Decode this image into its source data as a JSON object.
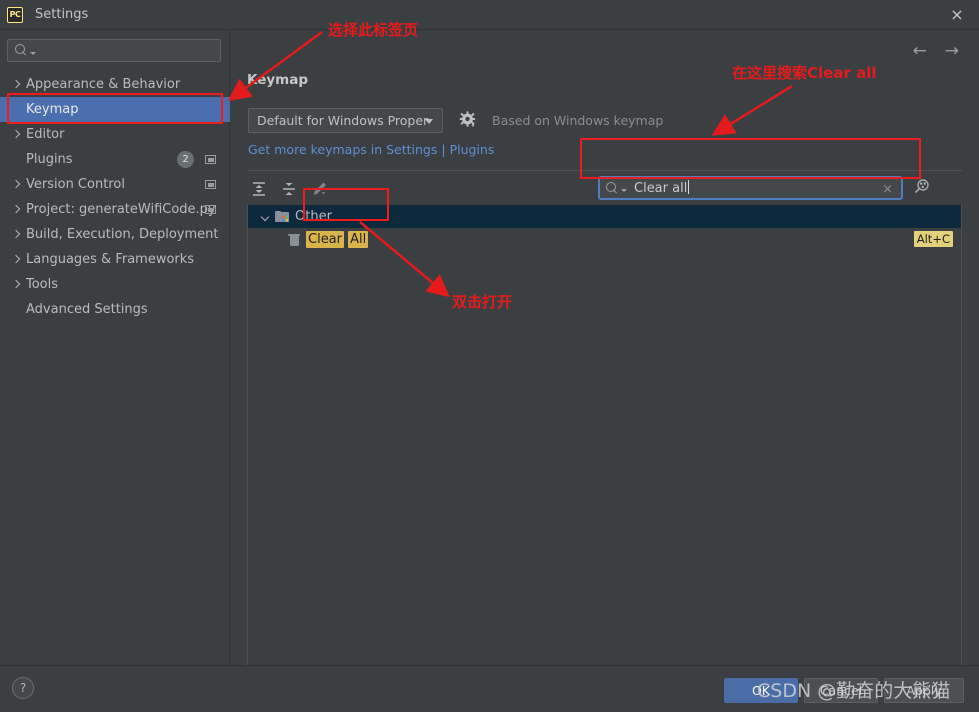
{
  "window": {
    "title": "Settings",
    "app_icon": "pycharm-icon",
    "close_icon": "×"
  },
  "sidebar": {
    "search_placeholder": "",
    "search_icon": "search-icon",
    "items": [
      {
        "label": "Appearance & Behavior",
        "expandable": true,
        "selected": false
      },
      {
        "label": "Keymap",
        "expandable": false,
        "selected": true
      },
      {
        "label": "Editor",
        "expandable": true,
        "selected": false
      },
      {
        "label": "Plugins",
        "expandable": false,
        "selected": false,
        "badge": "2",
        "has_mini": true
      },
      {
        "label": "Version Control",
        "expandable": true,
        "selected": false,
        "has_mini": true
      },
      {
        "label": "Project: generateWifiCode.py",
        "expandable": true,
        "selected": false,
        "has_mini": true
      },
      {
        "label": "Build, Execution, Deployment",
        "expandable": true,
        "selected": false
      },
      {
        "label": "Languages & Frameworks",
        "expandable": true,
        "selected": false
      },
      {
        "label": "Tools",
        "expandable": true,
        "selected": false
      },
      {
        "label": "Advanced Settings",
        "expandable": false,
        "selected": false
      }
    ]
  },
  "content": {
    "panel_title": "Keymap",
    "nav_back_icon": "←",
    "nav_forward_icon": "→",
    "keymap_select": {
      "value": "Default for Windows Proper",
      "caret_icon": "chevron-down-icon"
    },
    "gear_icon": "gear-icon",
    "based_on": "Based on Windows keymap",
    "link": {
      "text_before": "Get more keymaps in Settings",
      "separator": " | ",
      "text_after": "Plugins"
    },
    "toolbar": {
      "expand_all_icon": "expand-all-icon",
      "collapse_all_icon": "collapse-all-icon",
      "edit_icon": "edit-pencil-icon"
    },
    "search": {
      "value": "Clear all",
      "placeholder": "",
      "search_icon": "search-icon",
      "clear_icon": "×",
      "filter_icon": "find-shortcut-icon"
    },
    "results": [
      {
        "type": "group",
        "icon": "folder-icon",
        "label": "Other",
        "selected": true,
        "expanded": true
      },
      {
        "type": "action",
        "icon": "trash-icon",
        "label_parts": [
          {
            "text": "Clear",
            "highlight": true
          },
          {
            "text": " ",
            "highlight": false
          },
          {
            "text": "All",
            "highlight": true
          }
        ],
        "shortcut": "Alt+C",
        "selected": false
      }
    ]
  },
  "footer": {
    "help_icon": "?",
    "ok_label": "OK",
    "cancel_label": "Cancel",
    "apply_label": "Apply"
  },
  "watermark": "CSDN @勤奋的大熊猫",
  "annotations": [
    {
      "id": "anno-tab",
      "text": "选择此标签页"
    },
    {
      "id": "anno-search",
      "text": "在这里搜索Clear all"
    },
    {
      "id": "anno-open",
      "text": "双击打开"
    }
  ],
  "colors": {
    "accent_blue": "#4b6eaf",
    "annotation_red": "#e51b1b",
    "highlight_yellow": "#d9b44a",
    "link_blue": "#5c90d2",
    "selected_row": "#0d293e"
  }
}
